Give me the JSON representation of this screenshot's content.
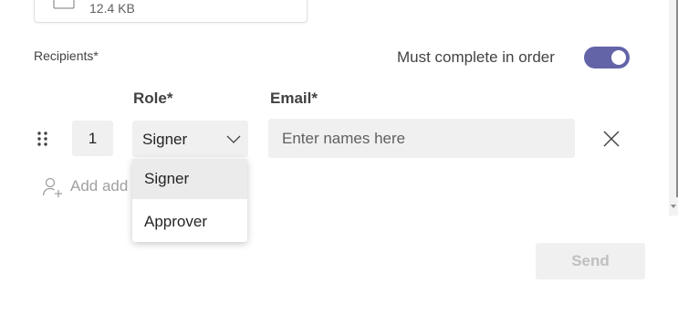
{
  "attachment": {
    "size": "12.4 KB",
    "icon": "word-document-icon"
  },
  "recipients": {
    "label": "Recipients*",
    "order_label": "Must complete in order",
    "order_toggle_on": true,
    "role_header": "Role*",
    "email_header": "Email*",
    "rows": [
      {
        "order": "1",
        "role": "Signer",
        "email_placeholder": "Enter names here"
      }
    ],
    "add_label": "Add add"
  },
  "role_dropdown": {
    "options": [
      "Signer",
      "Approver"
    ],
    "highlighted": "Signer"
  },
  "actions": {
    "send_label": "Send",
    "send_enabled": false
  },
  "colors": {
    "accent": "#6264a7",
    "field_bg": "#f0f0f0",
    "disabled_text": "#c0c0c0"
  }
}
